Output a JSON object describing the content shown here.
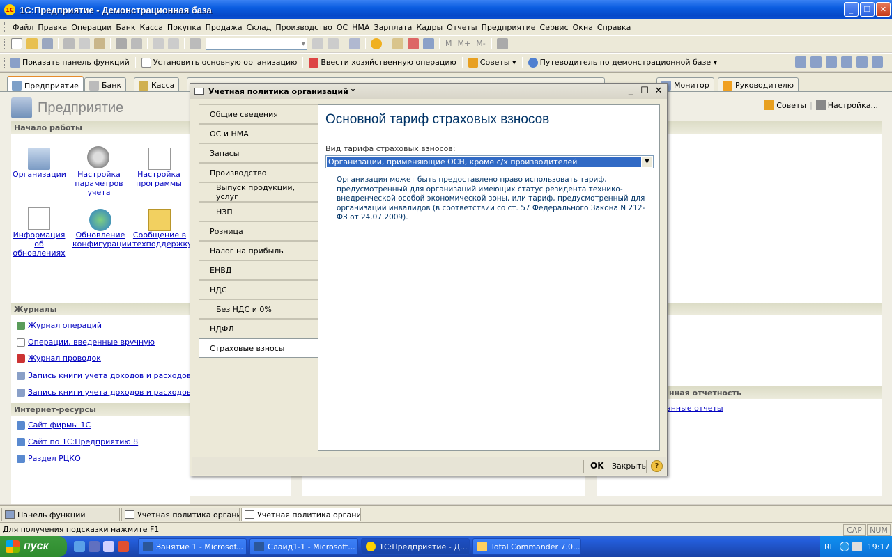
{
  "window": {
    "title": "1С:Предприятие - Демонстрационная база",
    "logo": "1С"
  },
  "menu": [
    "Файл",
    "Правка",
    "Операции",
    "Банк",
    "Касса",
    "Покупка",
    "Продажа",
    "Склад",
    "Производство",
    "ОС",
    "НМА",
    "Зарплата",
    "Кадры",
    "Отчеты",
    "Предприятие",
    "Сервис",
    "Окна",
    "Справка"
  ],
  "toolbar2": {
    "show_panel": "Показать панель функций",
    "set_org": "Установить основную организацию",
    "enter_op": "Ввести хозяйственную операцию",
    "tips": "Советы",
    "guide": "Путеводитель по демонстрационной базе"
  },
  "toolbar1": {
    "m": "M",
    "mplus": "M+",
    "mminus": "M-"
  },
  "tabs": [
    "Предприятие",
    "Банк",
    "Касса",
    "Монитор",
    "Руководителю"
  ],
  "panel": {
    "title": "Предприятие",
    "tips": "Советы",
    "settings": "Настройка...",
    "start_section": "Начало работы",
    "icons": [
      {
        "label": "Организации"
      },
      {
        "label": "Настройка параметров учета"
      },
      {
        "label": "Настройка программы"
      },
      {
        "label": "Информация об обновлениях"
      },
      {
        "label": "Обновление конфигурации"
      },
      {
        "label": "Сообщение в техподдержку"
      }
    ],
    "journals_section": "Журналы",
    "journals": [
      "Журнал операций",
      "Операции, введенные вручную",
      "Журнал проводок",
      "Запись книги учета доходов и расходов (УСН",
      "Запись книги учета доходов и расходов (ИП)"
    ],
    "internet_section": "Интернет-ресурсы",
    "internet": [
      "Сайт фирмы 1С",
      "Сайт по 1С:Предприятию 8",
      "Раздел РЦКО"
    ],
    "right_section": "нная отчетность",
    "right_link": "анные отчеты"
  },
  "dialog": {
    "title": "Учетная политика организаций *",
    "nav": [
      {
        "label": "Общие сведения",
        "sub": false
      },
      {
        "label": "ОС и НМА",
        "sub": false
      },
      {
        "label": "Запасы",
        "sub": false
      },
      {
        "label": "Производство",
        "sub": false
      },
      {
        "label": "Выпуск продукции, услуг",
        "sub": true
      },
      {
        "label": "НЗП",
        "sub": true
      },
      {
        "label": "Розница",
        "sub": false
      },
      {
        "label": "Налог на прибыль",
        "sub": false
      },
      {
        "label": "ЕНВД",
        "sub": false
      },
      {
        "label": "НДС",
        "sub": false
      },
      {
        "label": "Без НДС и 0%",
        "sub": true
      },
      {
        "label": "НДФЛ",
        "sub": false
      },
      {
        "label": "Страховые взносы",
        "sub": false,
        "active": true
      }
    ],
    "heading": "Основной тариф страховых взносов",
    "field_label": "Вид тарифа страховых взносов:",
    "field_value": "Организации, применяющие ОСН, кроме с/х производителей",
    "description": "Организация может быть предоставлено право использовать тариф, предусмотренный для организаций имеющих статус резидента технико-внедренческой особой экономической зоны, или тариф, предусмотренный для организаций инвалидов (в соответствии со ст. 57 Федерального Закона  N 212-ФЗ от 24.07.2009).",
    "ok": "OK",
    "close": "Закрыть",
    "help": "?"
  },
  "taskpanel": [
    "Панель функций",
    "Учетная политика организ...",
    "Учетная политика организ..."
  ],
  "status": {
    "hint": "Для получения подсказки нажмите F1",
    "cap": "CAP",
    "num": "NUM"
  },
  "taskbar": {
    "start": "пуск",
    "buttons": [
      "Занятие 1 - Microsof...",
      "Слайд1-1 - Microsoft...",
      "1С:Предприятие - Д...",
      "Total Commander 7.0..."
    ],
    "lang": "RL",
    "time": "19:17"
  },
  "colors": {
    "accent": "#0a5ce0",
    "link": "#0000c0",
    "heading": "#003366"
  }
}
